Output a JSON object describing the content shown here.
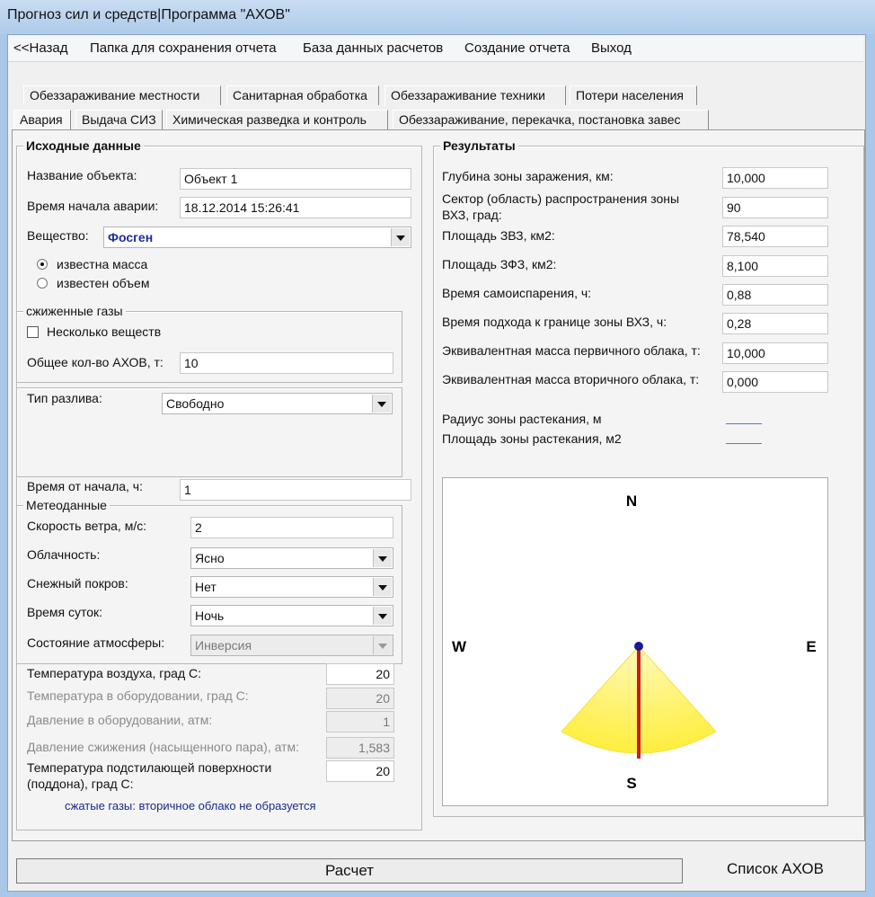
{
  "window": {
    "title": "Прогноз сил и средств|Программа \"АХОВ\""
  },
  "menu": {
    "back": "<<Назад",
    "folder": "Папка для сохранения отчета",
    "database": "База данных расчетов",
    "report": "Создание отчета",
    "exit": "Выход"
  },
  "tabs": {
    "row1": [
      "Обеззараживание местности",
      "Санитарная обработка",
      "Обеззараживание техники",
      "Потери населения"
    ],
    "row2": [
      "Авария",
      "Выдача СИЗ",
      "Химическая разведка и контроль",
      "Обеззараживание, перекачка, постановка завес"
    ]
  },
  "initial": {
    "legend": "Исходные данные",
    "object_name_label": "Название объекта:",
    "object_name_value": "Объект 1",
    "start_time_label": "Время начала аварии:",
    "start_time_value": "18.12.2014 15:26:41",
    "substance_label": "Вещество:",
    "substance_value": "Фосген",
    "radio_mass": "известна масса",
    "radio_volume": "известен объем",
    "liquefied_legend": "сжиженные газы",
    "several_substances": "Несколько веществ",
    "total_ahov_label": "Общее кол-во АХОВ, т:",
    "total_ahov_value": "10",
    "spill_type_label": "Тип разлива:",
    "spill_type_value": "Свободно",
    "time_from_start_label": "Время от начала, ч:",
    "time_from_start_value": "1"
  },
  "meteo": {
    "legend": "Метеоданные",
    "wind_label": "Скорость ветра, м/с:",
    "wind_value": "2",
    "cloud_label": "Облачность:",
    "cloud_value": "Ясно",
    "snow_label": "Снежный покров:",
    "snow_value": "Нет",
    "daytime_label": "Время суток:",
    "daytime_value": "Ночь",
    "atmosphere_label": "Состояние атмосферы:",
    "atmosphere_value": "Инверсия"
  },
  "temps": {
    "air_label": "Температура воздуха, град С:",
    "air_value": "20",
    "equip_label": "Температура в оборудовании, град С:",
    "equip_value": "20",
    "pressure_label": "Давление в оборудовании, атм:",
    "pressure_value": "1",
    "liq_pressure_label": "Давление сжижения (насыщенного пара), атм:",
    "liq_pressure_value": "1,583",
    "surface_label_1": "Температура подстилающей поверхности",
    "surface_label_2": "(поддона), град С:",
    "surface_value": "20",
    "note": "сжатые газы: вторичное облако не образуется"
  },
  "results": {
    "legend": "Результаты",
    "depth_label": "Глубина зоны заражения, км:",
    "depth_value": "10,000",
    "sector_label_1": "Сектор (область) распространения зоны",
    "sector_label_2": "ВХЗ, град:",
    "sector_value": "90",
    "zvz_label": "Площадь ЗВЗ, км2:",
    "zvz_value": "78,540",
    "zfz_label": "Площадь ЗФЗ, км2:",
    "zfz_value": "8,100",
    "evap_label": "Время самоиспарения, ч:",
    "evap_value": "0,88",
    "approach_label": "Время подхода к границе зоны ВХЗ, ч:",
    "approach_value": "0,28",
    "eq_primary_label": "Эквивалентная масса первичного облака, т:",
    "eq_primary_value": "10,000",
    "eq_secondary_label": "Эквивалентная масса вторичного облака, т:",
    "eq_secondary_value": "0,000",
    "radius_label": "Радиус зоны растекания, м",
    "area_label": "Площадь зоны растекания, м2"
  },
  "compass": {
    "n": "N",
    "s": "S",
    "w": "W",
    "e": "E",
    "sector_color": "#fff25c",
    "axis_color": "#cc1a1a",
    "center_color": "#1d1a8c"
  },
  "buttons": {
    "calculate": "Расчет",
    "ahov_list": "Список АХОВ"
  }
}
